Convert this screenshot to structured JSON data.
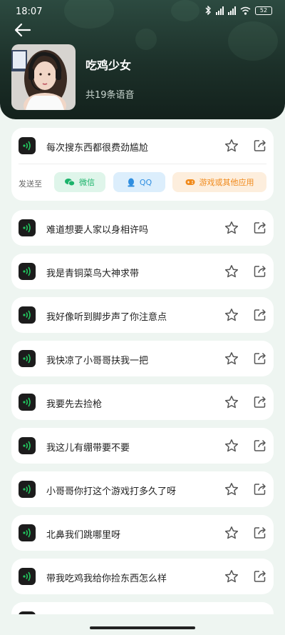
{
  "status_bar": {
    "time": "18:07",
    "battery": "52",
    "icons": [
      "bluetooth-icon",
      "signal-icon",
      "signal-icon",
      "wifi-icon",
      "battery-icon"
    ]
  },
  "header": {
    "title": "吃鸡少女",
    "subtitle": "共19条语音",
    "back_icon": "back-arrow-icon"
  },
  "send_to": {
    "label": "发送至",
    "wechat": "微信",
    "qq": "QQ",
    "game": "游戏或其他应用"
  },
  "voices": [
    "每次搜东西都很费劲尴尬",
    "难道想要人家以身相许吗",
    "我是青铜菜鸟大神求带",
    "我好像听到脚步声了你注意点",
    "我快凉了小哥哥扶我一把",
    "我要先去捡枪",
    "我这儿有绷带要不要",
    "小哥哥你打这个游戏打多久了呀",
    "北鼻我们跳哪里呀",
    "带我吃鸡我给你捡东西怎么样"
  ],
  "colors": {
    "header_bg": "#1c3029",
    "page_bg": "#eef5f1",
    "voice_green": "#22c55e",
    "wechat": "#1bb36b",
    "qq": "#2f8ee0",
    "game": "#f08a1c"
  }
}
